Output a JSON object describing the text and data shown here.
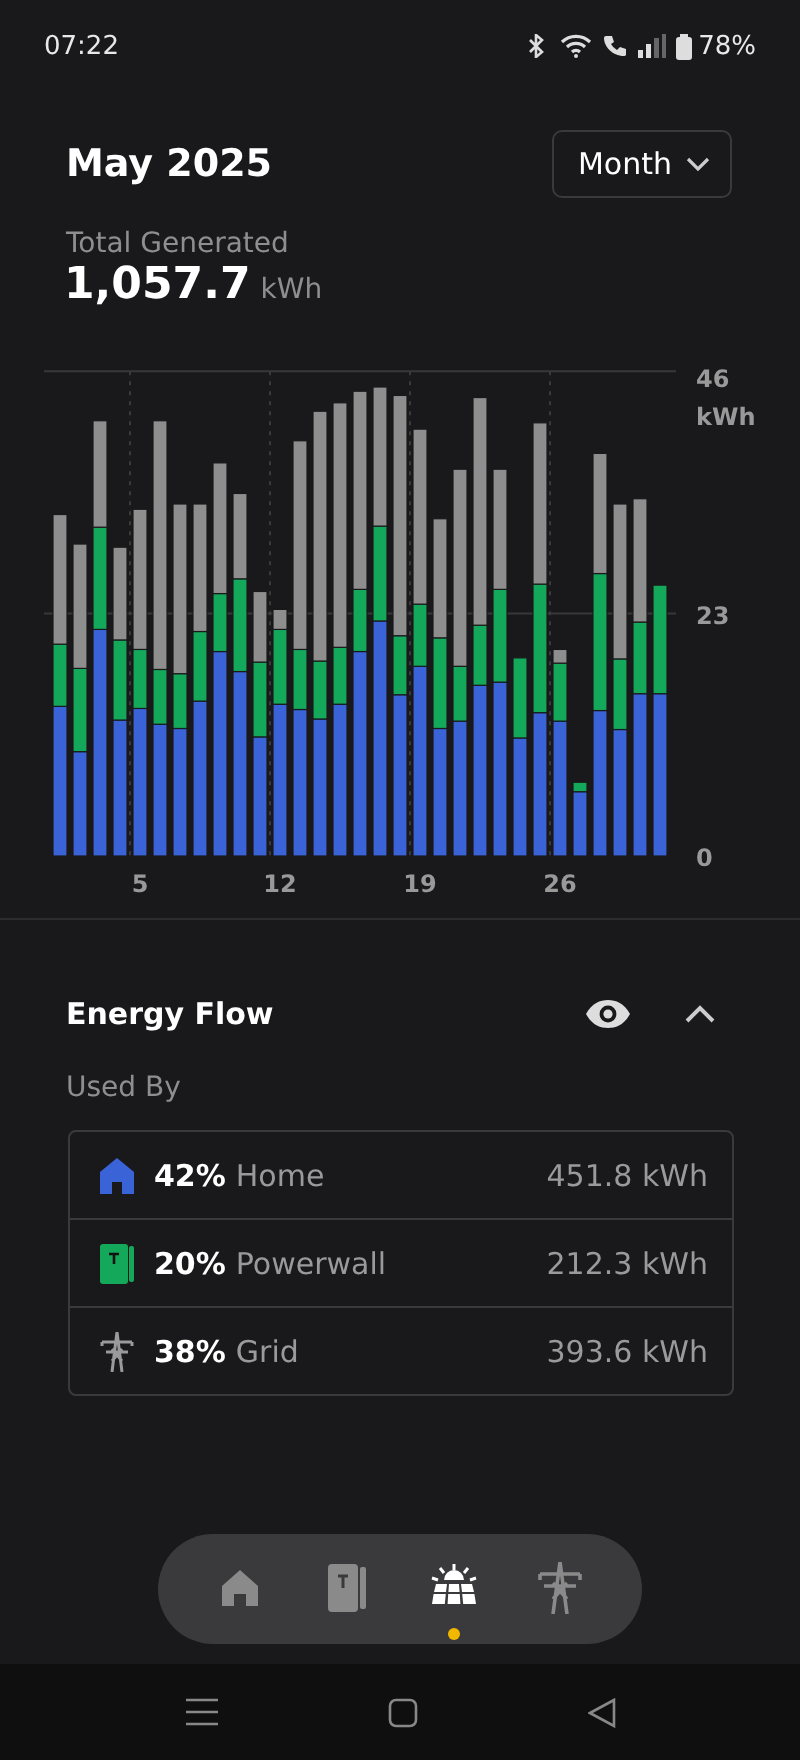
{
  "status_bar": {
    "time": "07:22",
    "battery": "78%"
  },
  "header": {
    "title": "May 2025",
    "period": "Month"
  },
  "total": {
    "label": "Total Generated",
    "value": "1,057.7",
    "unit": "kWh"
  },
  "chart_data": {
    "type": "bar",
    "stacked": true,
    "ylabel": "kWh",
    "xlim": [
      0.2,
      31.8
    ],
    "ylim": [
      0,
      46
    ],
    "yticks": [
      0,
      23,
      46
    ],
    "xticks": [
      5,
      12,
      19,
      26
    ],
    "x": [
      1,
      2,
      3,
      4,
      5,
      6,
      7,
      8,
      9,
      10,
      11,
      12,
      13,
      14,
      15,
      16,
      17,
      18,
      19,
      20,
      21,
      22,
      23,
      24,
      25,
      26,
      27,
      28,
      29,
      30,
      31
    ],
    "series": [
      {
        "color": "#3b63d8",
        "values": [
          14.2,
          9.9,
          21.5,
          12.9,
          14.0,
          12.5,
          12.1,
          14.7,
          19.4,
          17.5,
          11.3,
          14.4,
          13.9,
          13.0,
          14.4,
          19.4,
          22.3,
          15.3,
          18.0,
          12.1,
          12.8,
          16.2,
          16.5,
          11.2,
          13.6,
          12.8,
          6.1,
          13.8,
          12.0,
          15.4,
          15.4
        ]
      },
      {
        "color": "#14a85a",
        "values": [
          5.9,
          7.9,
          9.7,
          7.6,
          5.6,
          5.2,
          5.2,
          6.6,
          5.5,
          8.8,
          7.1,
          7.1,
          5.7,
          5.5,
          5.4,
          5.9,
          9.0,
          5.6,
          5.9,
          8.6,
          5.2,
          5.7,
          8.8,
          7.6,
          12.2,
          5.5,
          0.9,
          13.0,
          6.7,
          6.8,
          10.3
        ]
      },
      {
        "color": "#8e8e8e",
        "values": [
          12.3,
          11.8,
          10.1,
          8.8,
          13.3,
          23.6,
          16.1,
          12.1,
          12.4,
          8.1,
          6.7,
          1.9,
          19.8,
          23.7,
          23.2,
          18.8,
          13.2,
          22.8,
          16.6,
          11.3,
          18.7,
          21.6,
          11.4,
          0,
          15.3,
          1.3,
          0,
          11.4,
          14.7,
          11.7,
          0
        ]
      }
    ]
  },
  "energy_flow": {
    "title": "Energy Flow",
    "expanded": true,
    "subtitle": "Used By",
    "rows": [
      {
        "kind": "home",
        "percent": "42%",
        "label": "Home",
        "value": "451.8 kWh"
      },
      {
        "kind": "powerwall",
        "percent": "20%",
        "label": "Powerwall",
        "value": "212.3 kWh"
      },
      {
        "kind": "grid",
        "percent": "38%",
        "label": "Grid",
        "value": "393.6 kWh"
      }
    ]
  },
  "nav": [
    {
      "kind": "home",
      "selected": false
    },
    {
      "kind": "powerwall",
      "selected": false
    },
    {
      "kind": "solar",
      "selected": true
    },
    {
      "kind": "grid",
      "selected": false
    }
  ]
}
